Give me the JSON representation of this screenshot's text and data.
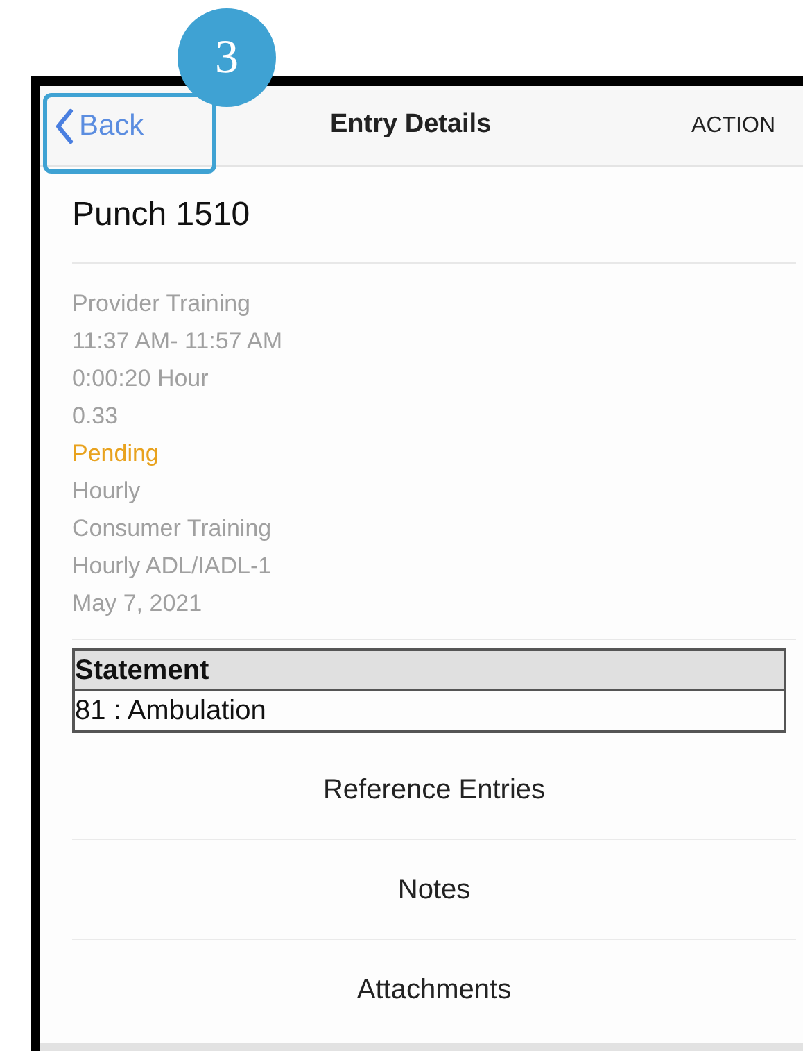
{
  "callout": {
    "label": "3"
  },
  "header": {
    "back": "Back",
    "title": "Entry Details",
    "action": "ACTION"
  },
  "entry_title": "Punch 1510",
  "details": [
    {
      "kind": "plain",
      "text": "Provider Training"
    },
    {
      "kind": "plain",
      "text": "11:37 AM- 11:57 AM"
    },
    {
      "kind": "plain",
      "text": "0:00:20 Hour"
    },
    {
      "kind": "plain",
      "text": "0.33"
    },
    {
      "kind": "status",
      "text": "Pending"
    },
    {
      "kind": "plain",
      "text": "Hourly"
    },
    {
      "kind": "plain",
      "text": "Consumer Training"
    },
    {
      "kind": "plain",
      "text": "Hourly ADL/IADL-1"
    },
    {
      "kind": "plain",
      "text": "May 7, 2021"
    }
  ],
  "statement_table": {
    "header": "Statement",
    "rows": [
      "81 : Ambulation"
    ]
  },
  "links": [
    "Reference Entries",
    "Notes",
    "Attachments"
  ]
}
